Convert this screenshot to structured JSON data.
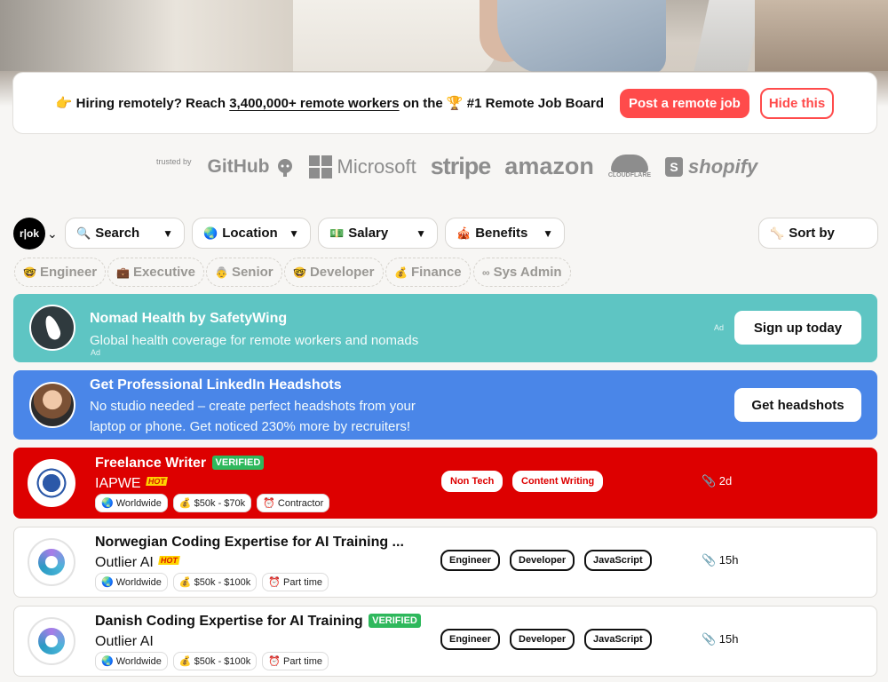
{
  "banner": {
    "emoji": "👉",
    "prefix": "Hiring remotely? Reach ",
    "link": "3,400,000+ remote workers",
    "middle": " on the ",
    "trophy": "🏆",
    "suffix": " #1 Remote Job Board",
    "post_button": "Post a remote job",
    "hide_button": "Hide this"
  },
  "trusted": {
    "label": "trusted by",
    "logos": [
      "GitHub",
      "Microsoft",
      "stripe",
      "amazon",
      "CLOUDFLARE",
      "shopify"
    ]
  },
  "brand": {
    "text": "r|ok"
  },
  "filters": [
    {
      "icon": "🔍",
      "label": "Search"
    },
    {
      "icon": "🌏",
      "label": "Location"
    },
    {
      "icon": "💵",
      "label": "Salary"
    },
    {
      "icon": "🎪",
      "label": "Benefits"
    },
    {
      "icon": "🦴",
      "label": "Sort by"
    }
  ],
  "tags": [
    {
      "icon": "🤓",
      "label": "Engineer"
    },
    {
      "icon": "💼",
      "label": "Executive"
    },
    {
      "icon": "👵",
      "label": "Senior"
    },
    {
      "icon": "🤓",
      "label": "Developer"
    },
    {
      "icon": "💰",
      "label": "Finance"
    },
    {
      "icon": "∞",
      "label": "Sys Admin"
    }
  ],
  "ads": [
    {
      "title": "Nomad Health by SafetyWing",
      "description": "Global health coverage for remote workers and nomads",
      "ad_label": "Ad",
      "button": "Sign up today"
    },
    {
      "title": "Get Professional LinkedIn Headshots",
      "description": "No studio needed – create perfect headshots from your laptop or phone. Get noticed 230% more by recruiters!",
      "button": "Get headshots"
    }
  ],
  "jobs": [
    {
      "title": "Freelance Writer",
      "verified": "VERIFIED",
      "company": "IAPWE",
      "hot": "HOT",
      "location": "🌏 Worldwide",
      "salary": "💰 $50k - $70k",
      "type": "⏰ Contractor",
      "categories": [
        "Non Tech",
        "Content Writing"
      ],
      "age": "📎 2d",
      "highlight": true
    },
    {
      "title": "Norwegian Coding Expertise for AI Training ...",
      "company": "Outlier AI",
      "hot": "HOT",
      "location": "🌏 Worldwide",
      "salary": "💰 $50k - $100k",
      "type": "⏰ Part time",
      "categories": [
        "Engineer",
        "Developer",
        "JavaScript"
      ],
      "age": "📎 15h"
    },
    {
      "title": "Danish Coding Expertise for AI Training",
      "verified": "VERIFIED",
      "company": "Outlier AI",
      "location": "🌏 Worldwide",
      "salary": "💰 $50k - $100k",
      "type": "⏰ Part time",
      "categories": [
        "Engineer",
        "Developer",
        "JavaScript"
      ],
      "age": "📎 15h"
    }
  ],
  "colors": {
    "accent_red": "#ff4b4b",
    "highlight_red": "#dd0000",
    "ad_teal": "#5ec5c3",
    "ad_blue": "#4a86e8",
    "verified_green": "#2eb85c"
  }
}
